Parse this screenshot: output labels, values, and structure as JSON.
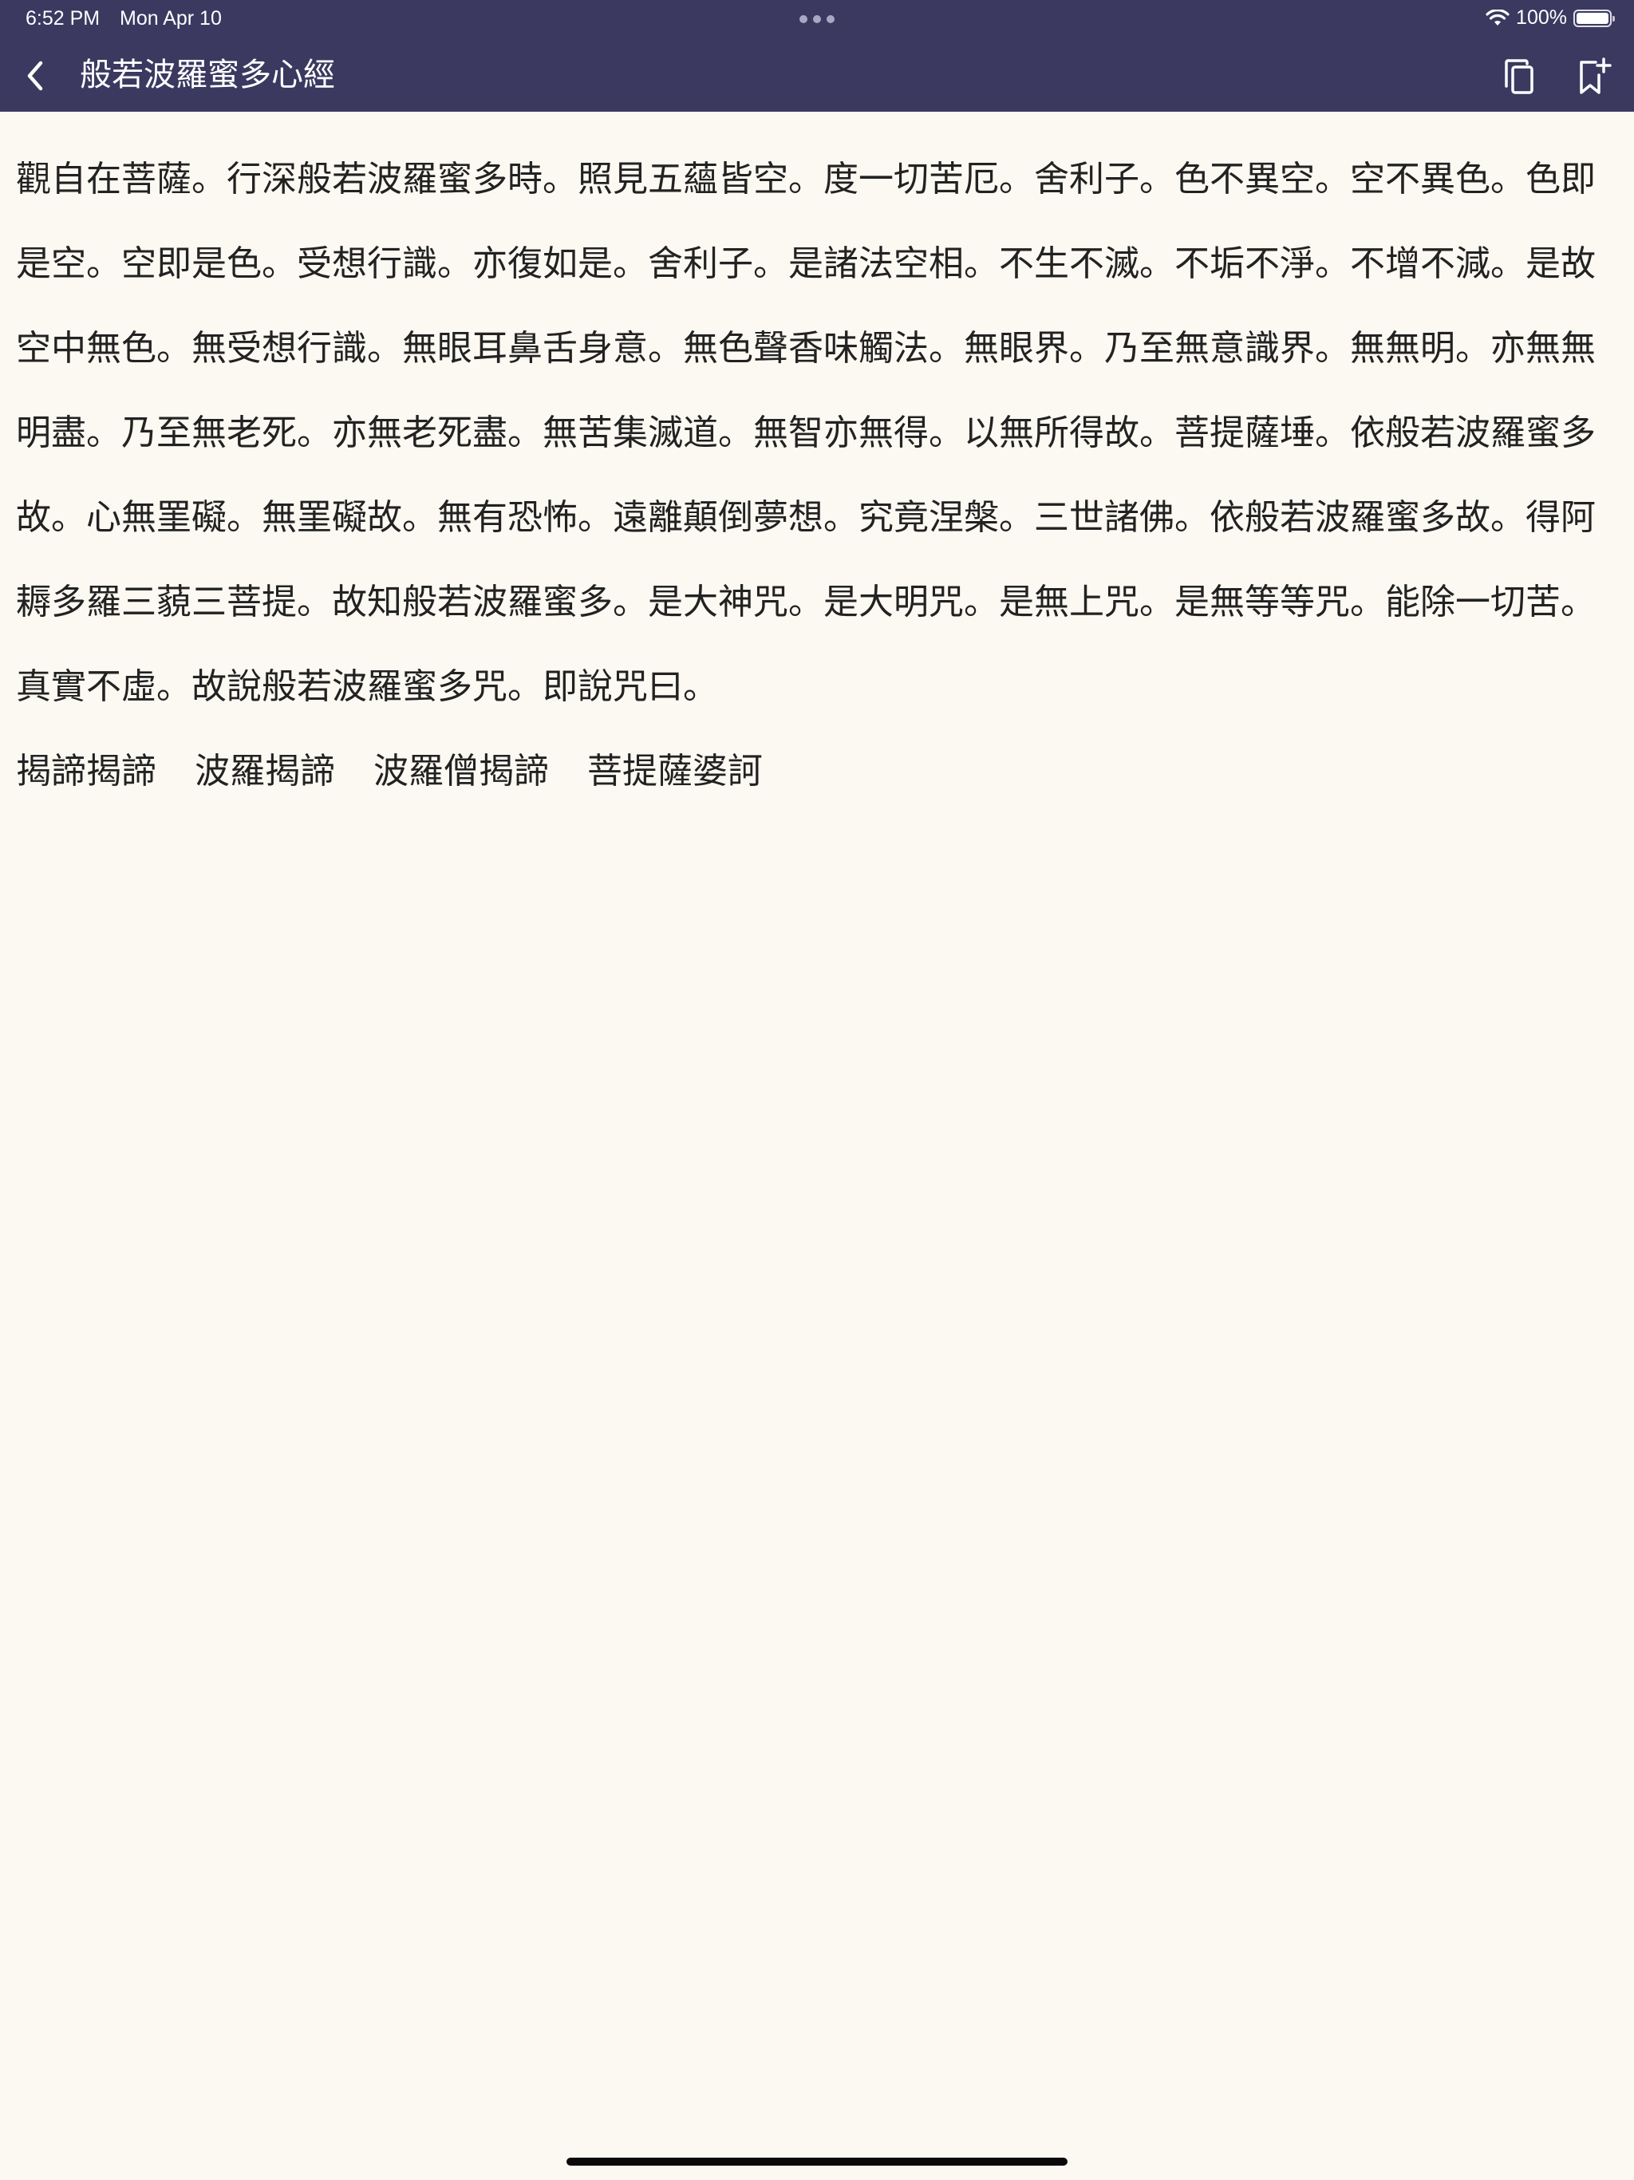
{
  "status_bar": {
    "time": "6:52 PM",
    "date": "Mon Apr 10",
    "battery": "100%"
  },
  "nav": {
    "title": "般若波羅蜜多心經",
    "back_icon": "chevron-left-icon",
    "copy_icon": "copy-icon",
    "bookmark_icon": "bookmark-add-icon"
  },
  "content": {
    "body": "觀自在菩薩。行深般若波羅蜜多時。照見五蘊皆空。度一切苦厄。舍利子。色不異空。空不異色。色即是空。空即是色。受想行識。亦復如是。舍利子。是諸法空相。不生不滅。不垢不淨。不增不減。是故空中無色。無受想行識。無眼耳鼻舌身意。無色聲香味觸法。無眼界。乃至無意識界。無無明。亦無無明盡。乃至無老死。亦無老死盡。無苦集滅道。無智亦無得。以無所得故。菩提薩埵。依般若波羅蜜多故。心無罣礙。無罣礙故。無有恐怖。遠離顛倒夢想。究竟涅槃。三世諸佛。依般若波羅蜜多故。得阿耨多羅三藐三菩提。故知般若波羅蜜多。是大神咒。是大明咒。是無上咒。是無等等咒。能除一切苦。真實不虛。故說般若波羅蜜多咒。即說咒曰。",
    "mantra": [
      "揭諦揭諦",
      "波羅揭諦",
      "波羅僧揭諦",
      "菩提薩婆訶"
    ]
  },
  "colors": {
    "header_bg": "#3b3960",
    "page_bg": "#fcf9f2",
    "text": "#222222"
  }
}
